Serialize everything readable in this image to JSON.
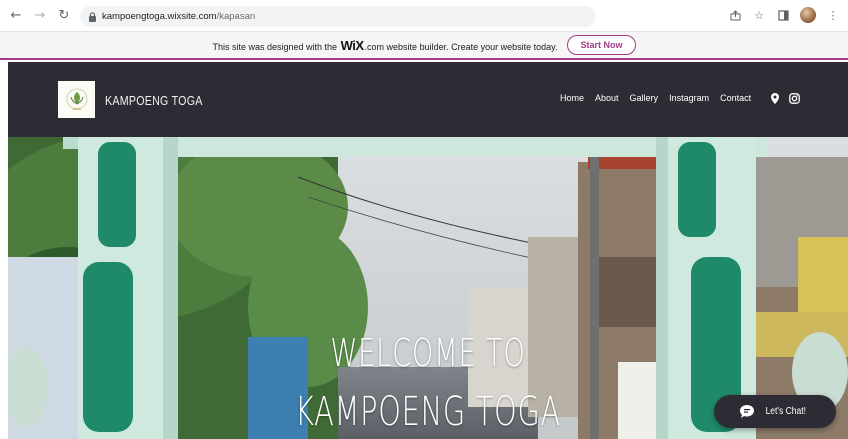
{
  "browser": {
    "url_domain": "kampoengtoga.wixsite.com",
    "url_path": "/kapasan"
  },
  "wix_banner": {
    "text_before": "This site was designed with the",
    "logo": "WiX",
    "text_after": ".com website builder. Create your website today.",
    "button": "Start Now",
    "accent_color": "#a23c8a"
  },
  "header": {
    "brand": "KAMPOENG TOGA",
    "nav": [
      "Home",
      "About",
      "Gallery",
      "Instagram",
      "Contact"
    ],
    "icons": [
      "location-pin-icon",
      "instagram-icon"
    ],
    "background": "#2d2c34"
  },
  "hero": {
    "line1": "WELCOME TO",
    "line2": "KAMPOENG TOGA"
  },
  "chat": {
    "label": "Let's Chat!"
  }
}
